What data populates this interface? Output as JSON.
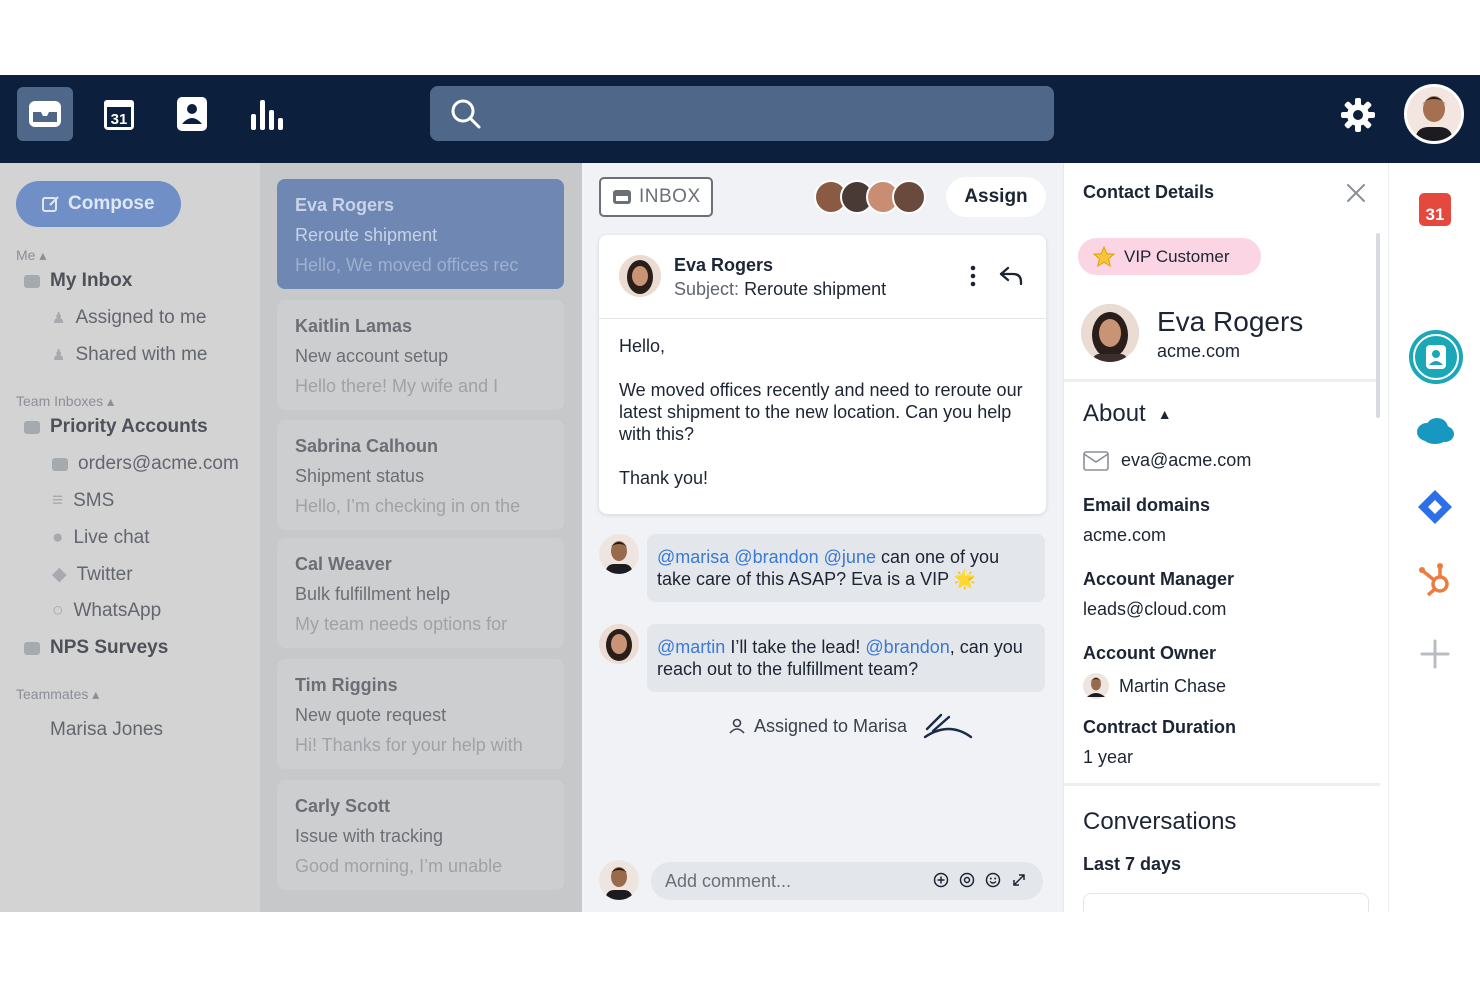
{
  "search": {
    "placeholder": ""
  },
  "sidebar": {
    "compose_label": "Compose",
    "me_label": "Me",
    "my_inbox": "My Inbox",
    "assigned_to_me": "Assigned to me",
    "shared_with_me": "Shared with me",
    "team_inboxes_label": "Team Inboxes",
    "priority_accounts": "Priority Accounts",
    "channels": [
      "orders@acme.com",
      "SMS",
      "Live chat",
      "Twitter",
      "WhatsApp"
    ],
    "nps_surveys": "NPS Surveys",
    "teammates_label": "Teammates",
    "teammate": "Marisa Jones"
  },
  "conversations": [
    {
      "name": "Eva Rogers",
      "subject": "Reroute shipment",
      "preview": "Hello, We moved offices rec"
    },
    {
      "name": "Kaitlin Lamas",
      "subject": "New account setup",
      "preview": "Hello there! My wife and I"
    },
    {
      "name": "Sabrina Calhoun",
      "subject": "Shipment status",
      "preview": "Hello, I’m checking in on the"
    },
    {
      "name": "Cal Weaver",
      "subject": "Bulk fulfillment help",
      "preview": "My team needs options for"
    },
    {
      "name": "Tim Riggins",
      "subject": "New quote request",
      "preview": "Hi! Thanks for your help with"
    },
    {
      "name": "Carly Scott",
      "subject": "Issue with tracking",
      "preview": "Good morning, I’m unable"
    }
  ],
  "thread": {
    "inbox_tag": "INBOX",
    "assign_label": "Assign",
    "email": {
      "from": "Eva Rogers",
      "subject_key": "Subject:",
      "subject": "Reroute shipment",
      "greeting": "Hello,",
      "body": "We moved offices recently and need to reroute our latest shipment to the new location. Can you help with this?",
      "signoff": "Thank you!"
    },
    "comment1": {
      "m1": "@marisa",
      "m2": "@brandon",
      "m3": "@june",
      "text": "can one of you take care of this ASAP? Eva is a VIP",
      "emoji": "🌟"
    },
    "comment2": {
      "m1": "@martin",
      "t1": "I’ll take the lead!",
      "m2": "@brandon",
      "t2": ", can you reach out to the fulfillment team?"
    },
    "assigned_note": "Assigned to Marisa",
    "add_comment_placeholder": "Add comment..."
  },
  "details": {
    "title": "Contact Details",
    "vip_label": "VIP Customer",
    "name": "Eva Rogers",
    "domain": "acme.com",
    "about_label": "About",
    "email": "eva@acme.com",
    "fields": [
      {
        "key": "Email domains",
        "value": "acme.com"
      },
      {
        "key": "Account Manager",
        "value": "leads@cloud.com"
      },
      {
        "key": "Account Owner",
        "value": "Martin Chase"
      },
      {
        "key": "Contract Duration",
        "value": "1 year"
      }
    ],
    "conversations_label": "Conversations",
    "last_7_days": "Last 7 days"
  },
  "rail": {
    "calendar_day": "31"
  },
  "topbar": {
    "calendar_day": "31"
  },
  "colors": {
    "topbar": "#0c1f3d",
    "accent": "#3a79d4",
    "vip": "#fbd5e3",
    "sidebar_dim": "#d3d3d4"
  }
}
